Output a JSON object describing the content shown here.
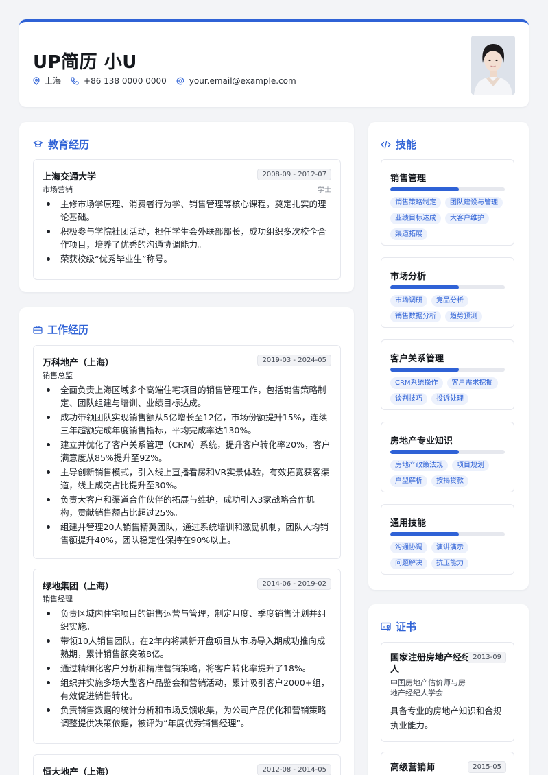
{
  "header": {
    "name": "UP简历 小U",
    "location": "上海",
    "phone": "+86 138 0000 0000",
    "email": "your.email@example.com"
  },
  "education": {
    "title": "教育经历",
    "school": "上海交通大学",
    "date": "2008-09 - 2012-07",
    "major": "市场营销",
    "degree": "学士",
    "bullets": [
      "主修市场学原理、消费者行为学、销售管理等核心课程，奠定扎实的理论基础。",
      "积极参与学院社团活动，担任学生会外联部部长，成功组织多次校企合作项目，培养了优秀的沟通协调能力。",
      "荣获校级“优秀毕业生”称号。"
    ]
  },
  "work": {
    "title": "工作经历",
    "jobs": [
      {
        "company": "万科地产（上海）",
        "date": "2019-03 - 2024-05",
        "role": "销售总监",
        "bullets": [
          "全面负责上海区域多个高端住宅项目的销售管理工作，包括销售策略制定、团队组建与培训、业绩目标达成。",
          "成功带领团队实现销售额从5亿增长至12亿，市场份额提升15%，连续三年超额完成年度销售指标，平均完成率达130%。",
          "建立并优化了客户关系管理（CRM）系统，提升客户转化率20%，客户满意度从85%提升至92%。",
          "主导创新销售模式，引入线上直播看房和VR实景体验，有效拓宽获客渠道，线上成交占比提升至30%。",
          "负责大客户和渠道合作伙伴的拓展与维护，成功引入3家战略合作机构，贡献销售额占比超过25%。",
          "组建并管理20人销售精英团队，通过系统培训和激励机制，团队人均销售额提升40%，团队稳定性保持在90%以上。"
        ]
      },
      {
        "company": "绿地集团（上海）",
        "date": "2014-06 - 2019-02",
        "role": "销售经理",
        "bullets": [
          "负责区域内住宅项目的销售运营与管理，制定月度、季度销售计划并组织实施。",
          "带领10人销售团队，在2年内将某新开盘项目从市场导入期成功推向成熟期，累计销售额突破8亿。",
          "通过精细化客户分析和精准营销策略，将客户转化率提升了18%。",
          "组织并实施多场大型客户品鉴会和营销活动，累计吸引客户2000+组，有效促进销售转化。",
          "负责销售数据的统计分析和市场反馈收集，为公司产品优化和营销策略调整提供决策依据，被评为“年度优秀销售经理”。"
        ]
      },
      {
        "company": "恒大地产（上海）",
        "date": "2012-08 - 2014-05"
      }
    ]
  },
  "skills": {
    "title": "技能",
    "groups": [
      {
        "name": "销售管理",
        "level": 0.6,
        "tags": [
          "销售策略制定",
          "团队建设与管理",
          "业绩目标达成",
          "大客户维护",
          "渠道拓展"
        ]
      },
      {
        "name": "市场分析",
        "level": 0.6,
        "tags": [
          "市场调研",
          "竞品分析",
          "销售数据分析",
          "趋势预测"
        ]
      },
      {
        "name": "客户关系管理",
        "level": 0.6,
        "tags": [
          "CRM系统操作",
          "客户需求挖掘",
          "谈判技巧",
          "投诉处理"
        ]
      },
      {
        "name": "房地产专业知识",
        "level": 0.6,
        "tags": [
          "房地产政策法规",
          "项目规划",
          "户型解析",
          "按揭贷款"
        ]
      },
      {
        "name": "通用技能",
        "level": 0.6,
        "tags": [
          "沟通协调",
          "演讲演示",
          "问题解决",
          "抗压能力"
        ]
      }
    ]
  },
  "certs": {
    "title": "证书",
    "items": [
      {
        "name": "国家注册房地产经纪人",
        "date": "2013-09",
        "org": "中国房地产估价师与房地产经纪人学会",
        "desc": "具备专业的房地产知识和合规执业能力。"
      },
      {
        "name": "高级营销师",
        "date": "2015-05"
      }
    ]
  }
}
